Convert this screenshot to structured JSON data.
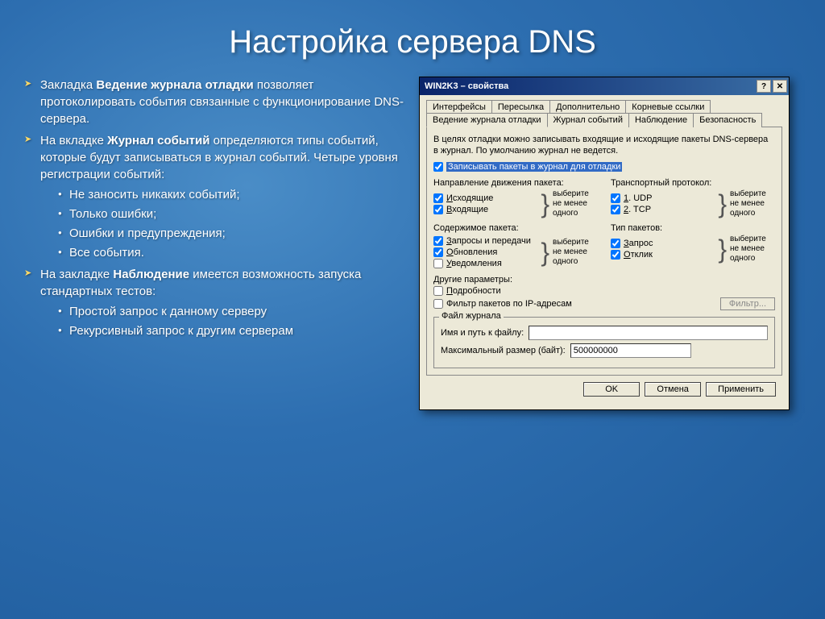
{
  "slide": {
    "title": "Настройка сервера DNS",
    "bullets": [
      {
        "prefix": "Закладка ",
        "bold": "Ведение журнала отладки",
        "suffix": " позволяет протоколировать события связанные с функционирование DNS-сервера."
      },
      {
        "prefix": "На вкладке ",
        "bold": "Журнал событий",
        "suffix": " определяются типы событий, которые будут записываться в журнал событий. Четыре уровня регистрации событий:",
        "sub": [
          "Не заносить никаких событий;",
          "Только ошибки;",
          "Ошибки и предупреждения;",
          "Все события."
        ]
      },
      {
        "prefix": "На закладке ",
        "bold": "Наблюдение",
        "suffix": " имеется возможность запуска стандартных тестов:",
        "sub": [
          "Простой запрос  к данному серверу",
          "Рекурсивный запрос к другим серверам"
        ]
      }
    ]
  },
  "dialog": {
    "title": "WIN2K3 – свойства",
    "tabs_row1": [
      "Интерфейсы",
      "Пересылка",
      "Дополнительно",
      "Корневые ссылки"
    ],
    "tabs_row2": [
      "Ведение журнала отладки",
      "Журнал событий",
      "Наблюдение",
      "Безопасность"
    ],
    "active_tab": "Ведение журнала отладки",
    "info": "В целях отладки можно записывать входящие и исходящие пакеты DNS-сервера в журнал. По умолчанию журнал не ведется.",
    "main_checkbox": "Записывать пакеты в журнал для отладки",
    "direction": {
      "label": "Направление движения пакета:",
      "items": [
        "Исходящие",
        "Входящие"
      ],
      "note": "выберите не менее одного"
    },
    "transport": {
      "label": "Транспортный протокол:",
      "items": [
        "1. UDP",
        "2. TCP"
      ],
      "note": "выберите не менее одного"
    },
    "content": {
      "label": "Содержимое пакета:",
      "items": [
        "Запросы и передачи",
        "Обновления",
        "Уведомления"
      ],
      "note": "выберите не менее одного"
    },
    "ptype": {
      "label": "Тип пакетов:",
      "items": [
        "Запрос",
        "Отклик"
      ],
      "note": "выберите не менее одного"
    },
    "other": {
      "label": "Другие параметры:",
      "details": "Подробности",
      "filter": "Фильтр пакетов по IP-адресам",
      "filter_btn": "Фильтр..."
    },
    "logfile": {
      "group": "Файл журнала",
      "path_label": "Имя и путь к файлу:",
      "path_value": "",
      "size_label": "Максимальный размер (байт):",
      "size_value": "500000000"
    },
    "buttons": {
      "ok": "OK",
      "cancel": "Отмена",
      "apply": "Применить"
    }
  }
}
